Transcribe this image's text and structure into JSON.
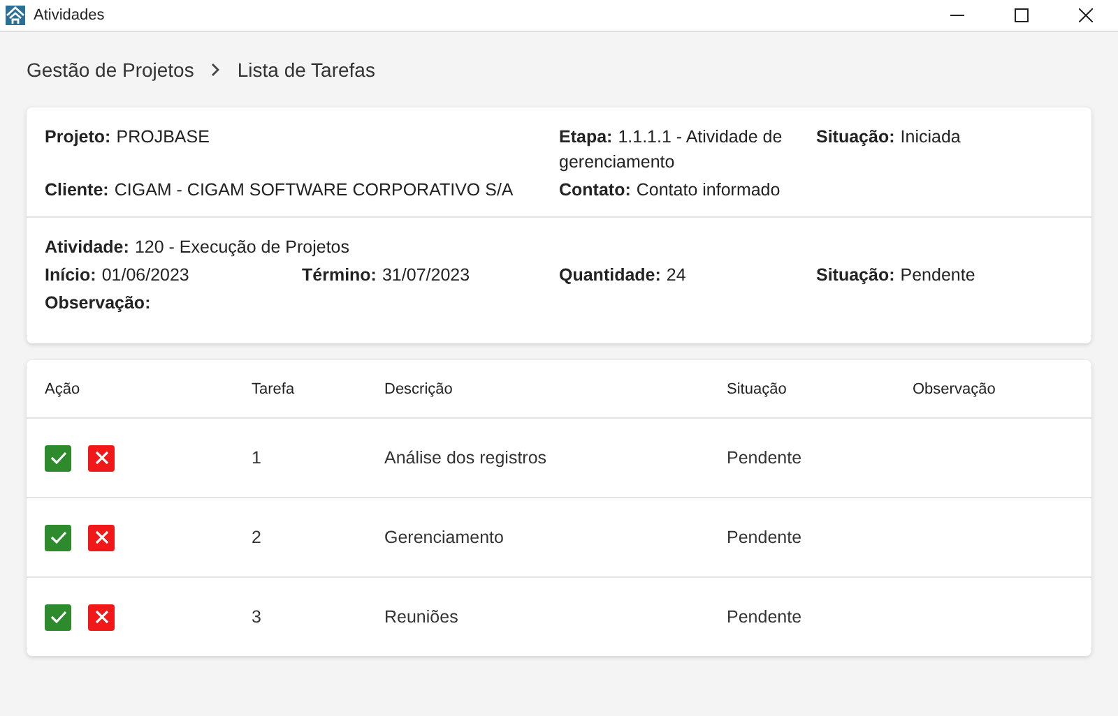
{
  "window": {
    "title": "Atividades"
  },
  "breadcrumb": [
    "Gestão de Projetos",
    "Lista de Tarefas"
  ],
  "header_sections": [
    {
      "fields": [
        {
          "label": "Projeto:",
          "value": "PROJBASE"
        },
        {
          "label": "Etapa:",
          "value": "1.1.1.1 - Atividade de gerenciamento"
        },
        {
          "label": "Situação:",
          "value": "Iniciada"
        },
        {
          "label": "Cliente:",
          "value": "CIGAM - CIGAM SOFTWARE CORPORATIVO S/A"
        },
        {
          "label": "Contato:",
          "value": "Contato informado"
        }
      ]
    },
    {
      "fields": [
        {
          "label": "Atividade:",
          "value": "120 - Execução de Projetos"
        },
        {
          "label": "Início:",
          "value": "01/06/2023"
        },
        {
          "label": "Término:",
          "value": "31/07/2023"
        },
        {
          "label": "Quantidade:",
          "value": "24"
        },
        {
          "label": "Situação:",
          "value": "Pendente"
        },
        {
          "label": "Observação:"
        }
      ]
    }
  ],
  "table": {
    "columns": [
      "Ação",
      "Tarefa",
      "Descrição",
      "Situação",
      "Observação"
    ],
    "rows": [
      {
        "task": "1",
        "description": "Análise dos registros",
        "status": "Pendente"
      },
      {
        "task": "2",
        "description": "Gerenciamento",
        "status": "Pendente"
      },
      {
        "task": "3",
        "description": "Reuniões",
        "status": "Pendente"
      }
    ]
  }
}
